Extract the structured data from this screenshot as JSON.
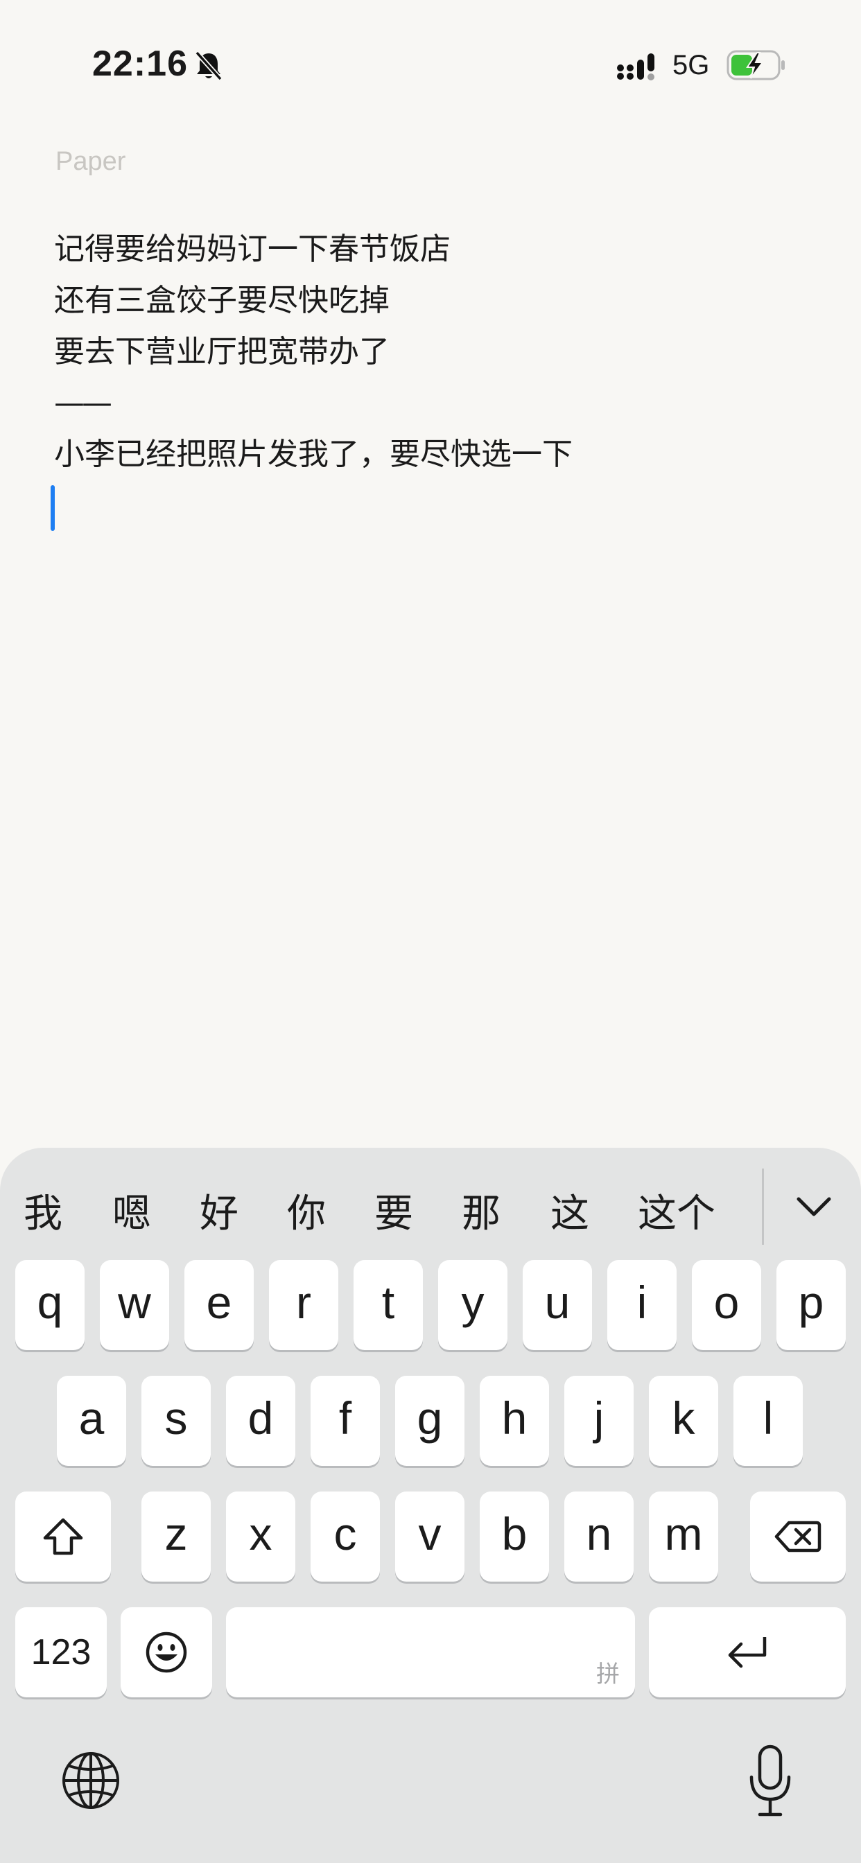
{
  "status_bar": {
    "time": "22:16",
    "network": "5G",
    "icons": [
      "bell-muted-icon",
      "signal-icon",
      "battery-charging-icon"
    ],
    "battery_color": "#3ec23a"
  },
  "note": {
    "title_placeholder": "Paper",
    "lines": [
      "记得要给妈妈订一下春节饭店",
      "还有三盒饺子要尽快吃掉",
      "要去下营业厅把宽带办了",
      "——",
      "小李已经把照片发我了，要尽快选一下"
    ],
    "cursor_color": "#1e7ef2"
  },
  "keyboard": {
    "candidates": [
      "我",
      "嗯",
      "好",
      "你",
      "要",
      "那",
      "这",
      "这个"
    ],
    "collapse_icon": "chevron-down-icon",
    "row1": [
      "q",
      "w",
      "e",
      "r",
      "t",
      "y",
      "u",
      "i",
      "o",
      "p"
    ],
    "row2": [
      "a",
      "s",
      "d",
      "f",
      "g",
      "h",
      "j",
      "k",
      "l"
    ],
    "row3": [
      "z",
      "x",
      "c",
      "v",
      "b",
      "n",
      "m"
    ],
    "shift_icon": "shift-icon",
    "delete_icon": "delete-icon",
    "numbers_label": "123",
    "emoji_icon": "emoji-icon",
    "space_hint": "拼",
    "return_icon": "return-icon",
    "globe_icon": "globe-icon",
    "mic_icon": "microphone-icon"
  }
}
